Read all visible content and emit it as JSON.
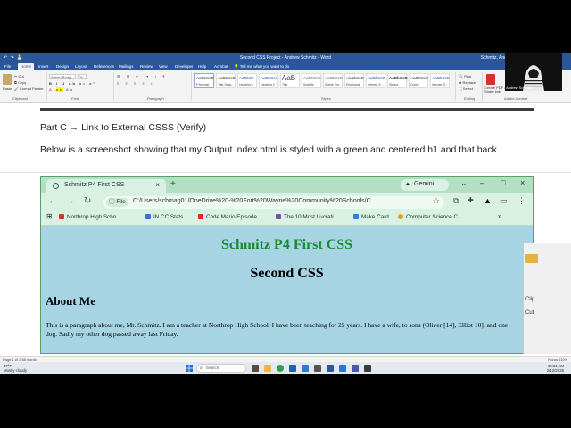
{
  "word": {
    "title": "Second CSS Project - Andrew Schmitz - Word",
    "user": "Schmitz, Andrew",
    "quick_access": "↶ ↷ 💾",
    "tabs": [
      "File",
      "Home",
      "Insert",
      "Design",
      "Layout",
      "References",
      "Mailings",
      "Review",
      "View",
      "Developer",
      "Help",
      "Acrobat"
    ],
    "tell_me": "Tell me what you want to do",
    "ribbon": {
      "paste": "Paste",
      "clipboard_items": [
        "Cut",
        "Copy",
        "Format Painter"
      ],
      "font_name": "Aptos (Body)",
      "font_size": "11",
      "group_labels": [
        "Clipboard",
        "Font",
        "Paragraph",
        "Styles",
        "Editing",
        "Adobe Acrobat"
      ],
      "styles": [
        {
          "sample": "AaBbCcD",
          "name": "¶ Normal"
        },
        {
          "sample": "AaBbCcD",
          "name": "Title Spac..."
        },
        {
          "sample": "AaBbCc",
          "name": "Heading 1"
        },
        {
          "sample": "AaBbCcI",
          "name": "Heading 2"
        },
        {
          "sample": "AaB",
          "name": "Title"
        },
        {
          "sample": "AaBbCcD",
          "name": "Subtitle"
        },
        {
          "sample": "AaBbCcD",
          "name": "Subtle Em..."
        },
        {
          "sample": "AaBbCcD",
          "name": "Emphasis"
        },
        {
          "sample": "AaBbCcD",
          "name": "Intense E..."
        },
        {
          "sample": "AaBbCcD",
          "name": "Strong"
        },
        {
          "sample": "AaBbCcD",
          "name": "Quote"
        },
        {
          "sample": "AaBbCcD",
          "name": "Intense Q..."
        }
      ],
      "editing": [
        "Find",
        "Replace",
        "Select"
      ],
      "acrobat": "Create PDF and Share link"
    },
    "doc": {
      "heading": "Part C → Link to External CSSS (Verify)",
      "body": "Below is a screenshot showing that my Output index.html is styled with a green and centered h1 and that back"
    },
    "status_left": "Page 1 of 2    68 words",
    "status_right": "Focus    110%"
  },
  "chrome": {
    "tab_title": "Schmitz P4 First CSS",
    "tab_close": "×",
    "new_tab": "+",
    "gemini": "Gemini",
    "window_controls": [
      "⌄",
      "–",
      "□",
      "×"
    ],
    "nav": [
      "←",
      "→",
      "↻"
    ],
    "file_chip": "File",
    "url": "C:/Users/schmag01/OneDrive%20-%20Fort%20Wayne%20Community%20Schools/C...",
    "bookmarks": [
      {
        "label": "Northrop High Scho...",
        "color": "#c23b2b"
      },
      {
        "label": "IN CC Stats",
        "color": "#3f6fd1"
      },
      {
        "label": "Code Mario Episode...",
        "color": "#e5261d"
      },
      {
        "label": "The 10 Most Lucrati...",
        "color": "#7a4ea5"
      },
      {
        "label": "Make Card",
        "color": "#2f7fd6"
      },
      {
        "label": "Computer Science C...",
        "color": "#e0a21a"
      }
    ],
    "bookmarks_more": "»",
    "page": {
      "h1": "Schmitz P4 First CSS",
      "h2": "Second CSS",
      "h3": "About Me",
      "p": "This is a paragraph about me, Mr. Schmitz. I am a teacher at Northrop High School. I have been teaching for 25 years. I have a wife, to sons (Oliver [14], Elliot 10], and one dog. Sadly my other dog passed away last Friday."
    }
  },
  "taskbar": {
    "weather_temp": "37°F",
    "weather_desc": "Mostly cloudy",
    "search": "Search",
    "time": "10:31 AM",
    "date": "2/12/2025"
  },
  "webcam": {
    "label": "Andrew Schmitz"
  }
}
